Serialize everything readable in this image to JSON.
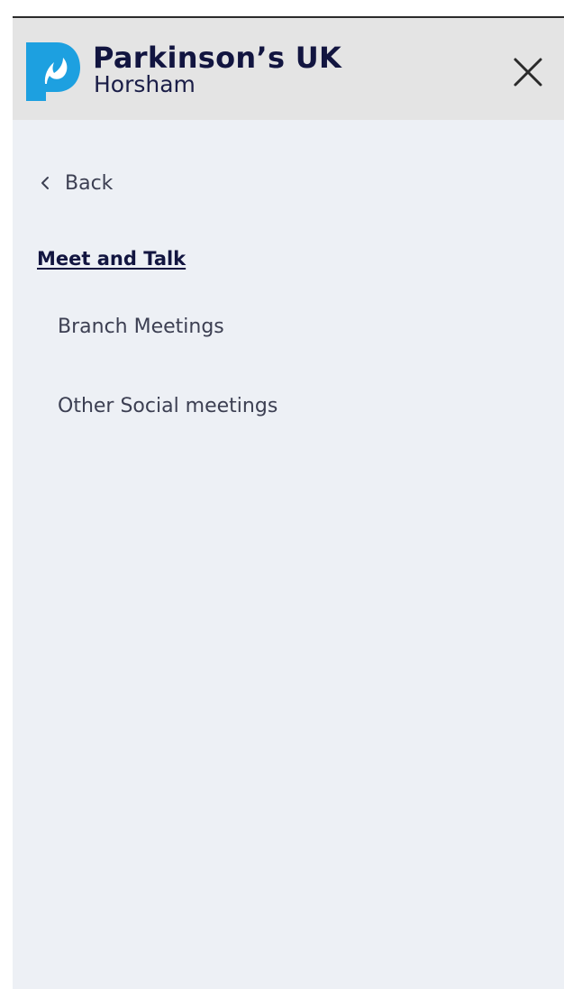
{
  "header": {
    "brand_name": "Parkinson’s UK",
    "branch_name": "Horsham",
    "logo_icon": "parkinsons-uk-logo-icon",
    "close_icon": "close-icon"
  },
  "nav": {
    "back_label": "Back",
    "back_icon": "chevron-left-icon",
    "section_title": "Meet and Talk",
    "items": [
      {
        "label": "Branch Meetings"
      },
      {
        "label": "Other Social meetings"
      }
    ]
  },
  "colors": {
    "brand_blue": "#1da0e0",
    "navy_text": "#121540",
    "body_text": "#3c3f52",
    "header_bg": "#e4e4e4",
    "panel_bg": "#edf0f5"
  }
}
